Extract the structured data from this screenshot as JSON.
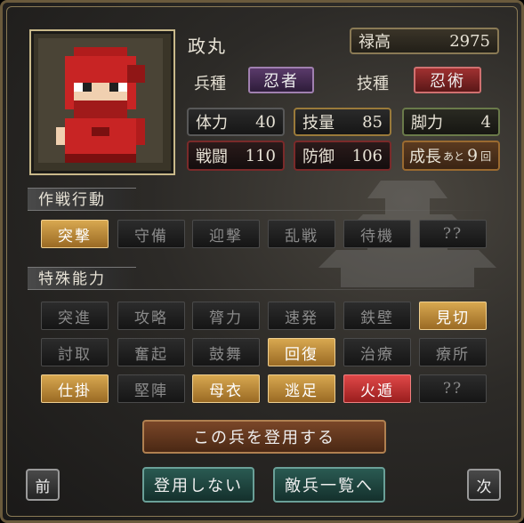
{
  "unit": {
    "name": "政丸",
    "salary_label": "禄高",
    "salary_value": "2975",
    "troop_type_label": "兵種",
    "troop_type_value": "忍者",
    "skill_type_label": "技種",
    "skill_type_value": "忍術",
    "stats": {
      "hp_label": "体力",
      "hp_value": "40",
      "skill_label": "技量",
      "skill_value": "85",
      "leg_label": "脚力",
      "leg_value": "4",
      "atk_label": "戦闘",
      "atk_value": "110",
      "def_label": "防御",
      "def_value": "106",
      "growth_label": "成長",
      "growth_small": "あと",
      "growth_value": "9",
      "growth_unit": "回"
    }
  },
  "tactics": {
    "heading": "作戦行動",
    "items": [
      {
        "label": "突撃",
        "state": "on"
      },
      {
        "label": "守備",
        "state": "off"
      },
      {
        "label": "迎撃",
        "state": "off"
      },
      {
        "label": "乱戦",
        "state": "off"
      },
      {
        "label": "待機",
        "state": "off"
      },
      {
        "label": "??",
        "state": "off"
      }
    ]
  },
  "abilities": {
    "heading": "特殊能力",
    "rows": [
      [
        {
          "label": "突進",
          "state": "off"
        },
        {
          "label": "攻略",
          "state": "off"
        },
        {
          "label": "膂力",
          "state": "off"
        },
        {
          "label": "速発",
          "state": "off"
        },
        {
          "label": "鉄壁",
          "state": "off"
        },
        {
          "label": "見切",
          "state": "on"
        }
      ],
      [
        {
          "label": "討取",
          "state": "off"
        },
        {
          "label": "奮起",
          "state": "off"
        },
        {
          "label": "鼓舞",
          "state": "off"
        },
        {
          "label": "回復",
          "state": "on"
        },
        {
          "label": "治療",
          "state": "off"
        },
        {
          "label": "療所",
          "state": "off"
        }
      ],
      [
        {
          "label": "仕掛",
          "state": "on"
        },
        {
          "label": "堅陣",
          "state": "off"
        },
        {
          "label": "母衣",
          "state": "on"
        },
        {
          "label": "逃足",
          "state": "on"
        },
        {
          "label": "火遁",
          "state": "red"
        },
        {
          "label": "??",
          "state": "off"
        }
      ]
    ]
  },
  "actions": {
    "recruit": "この兵を登用する",
    "decline": "登用しない",
    "enemy_list": "敵兵一覧へ",
    "prev": "前",
    "next": "次"
  },
  "colors": {
    "active_gold": "#d8a850",
    "active_red": "#e04848",
    "troop_badge": "#5a3a6a",
    "skill_badge": "#a03030"
  }
}
